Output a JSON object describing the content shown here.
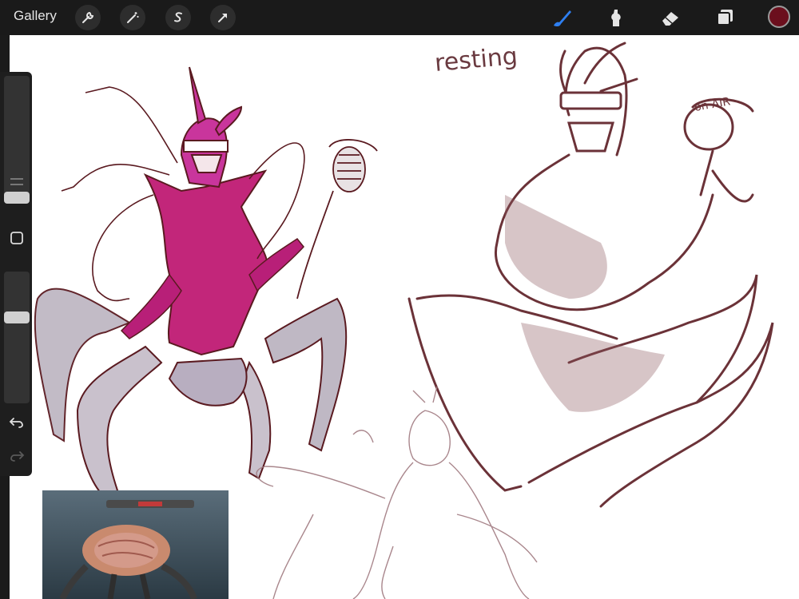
{
  "topbar": {
    "gallery_label": "Gallery",
    "left_tools": [
      "wrench-icon",
      "magic-wand-icon",
      "selection-icon",
      "transform-arrow-icon"
    ],
    "right_tools": [
      "brush-icon",
      "smudge-icon",
      "eraser-icon",
      "layers-icon"
    ],
    "active_tool": "brush-icon",
    "active_color": "#6b0f1d"
  },
  "canvas": {
    "sketch_annotations": {
      "resting": "resting",
      "on_air": "on AIR"
    },
    "stroke_colors": {
      "pink_fill": "#c2267a",
      "dark_line": "#5a1a20",
      "sketch_brown": "#8b5a5e",
      "grey_fill": "#bfb8c4"
    }
  },
  "sidebar": {
    "brush_size_level": 0.6,
    "opacity_level": 0.63,
    "controls": [
      "modify-square-icon",
      "undo-icon",
      "redo-icon"
    ]
  }
}
